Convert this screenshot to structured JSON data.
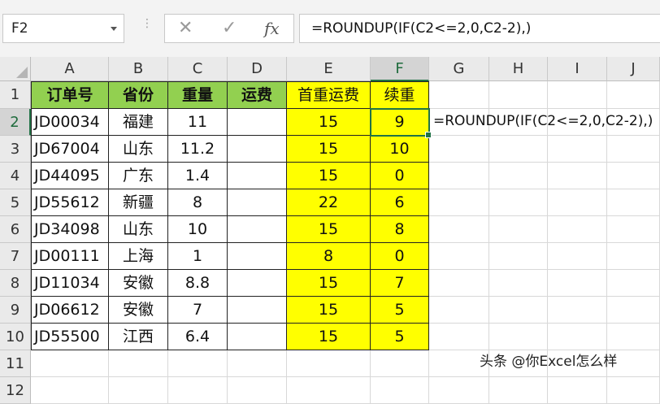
{
  "name_box": {
    "value": "F2"
  },
  "formula_bar": {
    "cancel_glyph": "✕",
    "enter_glyph": "✓",
    "fx_label": "fx",
    "formula": "=ROUNDUP(IF(C2<=2,0,C2-2),)"
  },
  "columns": [
    "A",
    "B",
    "C",
    "D",
    "E",
    "F",
    "G",
    "H",
    "I",
    "J"
  ],
  "rows": [
    "1",
    "2",
    "3",
    "4",
    "5",
    "6",
    "7",
    "8",
    "9",
    "10",
    "11",
    "12"
  ],
  "selected_cell": "F2",
  "table": {
    "headers": [
      "订单号",
      "省份",
      "重量",
      "运费",
      "首重运费",
      "续重"
    ],
    "rows": [
      [
        "JD00034",
        "福建",
        "11",
        "",
        "15",
        "9"
      ],
      [
        "JD67004",
        "山东",
        "11.2",
        "",
        "15",
        "10"
      ],
      [
        "JD44095",
        "广东",
        "1.4",
        "",
        "15",
        "0"
      ],
      [
        "JD55612",
        "新疆",
        "8",
        "",
        "22",
        "6"
      ],
      [
        "JD34098",
        "山东",
        "10",
        "",
        "15",
        "8"
      ],
      [
        "JD00111",
        "上海",
        "1",
        "",
        "8",
        "0"
      ],
      [
        "JD11034",
        "安徽",
        "8.8",
        "",
        "15",
        "7"
      ],
      [
        "JD06612",
        "安徽",
        "7",
        "",
        "15",
        "5"
      ],
      [
        "JD55500",
        "江西",
        "6.4",
        "",
        "15",
        "5"
      ]
    ]
  },
  "g2_text": "=ROUNDUP(IF(C2<=2,0,C2-2),)",
  "watermark": "头条 @你Excel怎么样",
  "colors": {
    "header_green": "#92d050",
    "highlight_yellow": "#ffff00",
    "excel_green": "#217346"
  }
}
